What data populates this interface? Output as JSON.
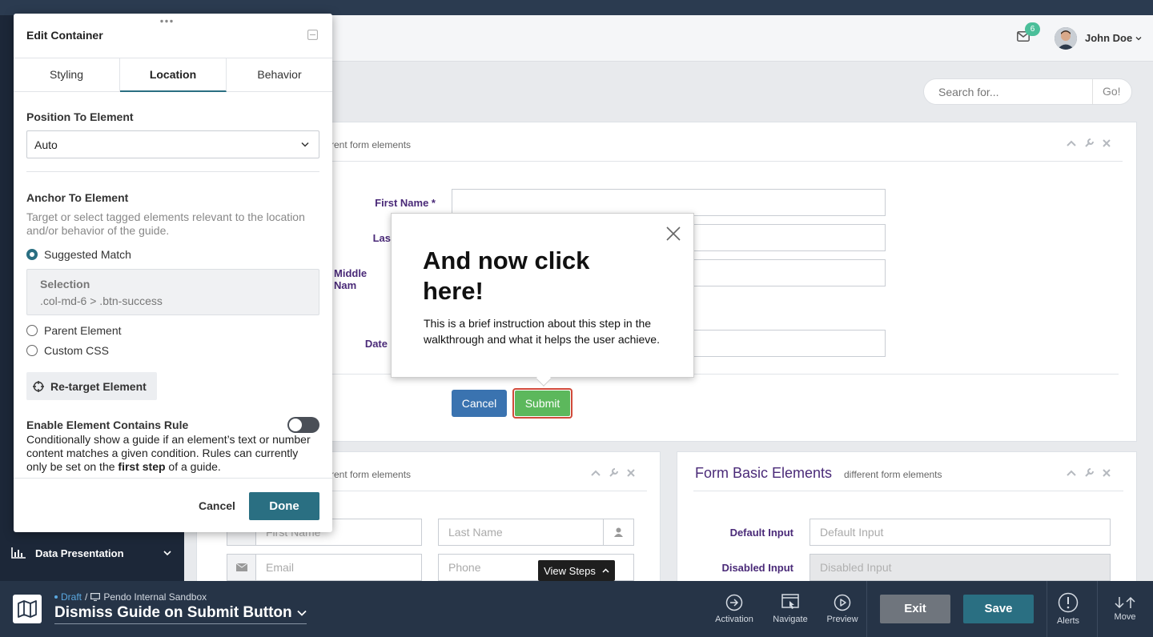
{
  "header": {
    "notifications_count": "6",
    "user_name": "John Doe"
  },
  "search": {
    "placeholder": "Search for...",
    "go_label": "Go!"
  },
  "top_panel": {
    "subtitle": "rent form elements",
    "fields": {
      "first_name": "First Name *",
      "last_name": "Las",
      "middle_name": "Middle Nam",
      "date": "Date"
    },
    "cancel_label": "Cancel",
    "submit_label": "Submit"
  },
  "bottom_left_panel": {
    "subtitle": "rent form elements",
    "first_name_placeholder": "First Name",
    "last_name_placeholder": "Last Name",
    "email_placeholder": "Email",
    "phone_placeholder": "Phone"
  },
  "bottom_right_panel": {
    "title": "Form Basic Elements",
    "subtitle": "different form elements",
    "default_label": "Default Input",
    "default_placeholder": "Default Input",
    "disabled_label": "Disabled Input",
    "disabled_placeholder": "Disabled Input"
  },
  "sidebar": {
    "data_presentation_label": "Data Presentation"
  },
  "view_steps_label": "View Steps",
  "guide_popup": {
    "heading": "And now click here!",
    "body": "This is a brief instruction about this step in the walkthrough and what it helps the user achieve."
  },
  "edit_container": {
    "title": "Edit Container",
    "tabs": [
      "Styling",
      "Location",
      "Behavior"
    ],
    "active_tab": "Location",
    "position_title": "Position To Element",
    "position_value": "Auto",
    "anchor_title": "Anchor To Element",
    "anchor_help": "Target or select tagged elements relevant to the location and/or behavior of the guide.",
    "options": {
      "suggested": "Suggested Match",
      "parent": "Parent Element",
      "custom": "Custom CSS"
    },
    "selection_label": "Selection",
    "selection_value": ".col-md-6 > .btn-success",
    "retarget_label": "Re-target Element",
    "contains_title": "Enable Element Contains Rule",
    "contains_help_1": "Conditionally show a guide if an element’s text or number content matches a given condition. Rules can currently only be set on the ",
    "contains_help_bold": "first step",
    "contains_help_2": " of a guide.",
    "contains_enabled": false,
    "cancel_label": "Cancel",
    "done_label": "Done"
  },
  "bottom_bar": {
    "status": "Draft",
    "separator": "/",
    "app_name": "Pendo Internal Sandbox",
    "guide_name": "Dismiss Guide on Submit Button",
    "tools": {
      "activation": "Activation",
      "navigate": "Navigate",
      "preview": "Preview",
      "alerts": "Alerts",
      "move": "Move"
    },
    "exit_label": "Exit",
    "save_label": "Save"
  }
}
